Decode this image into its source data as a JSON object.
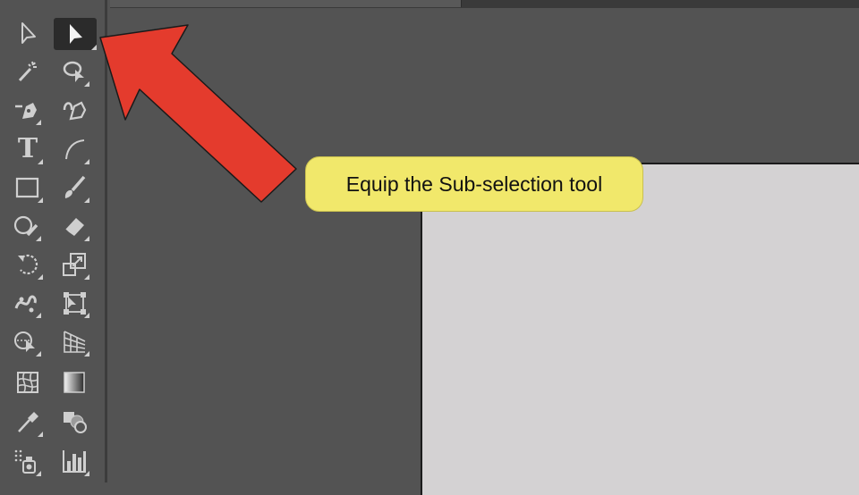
{
  "callout": {
    "text": "Equip the Sub-selection tool"
  },
  "toolbar": {
    "tools": [
      {
        "id": "selection",
        "icon": "selection-arrow-icon"
      },
      {
        "id": "direct-selection",
        "icon": "direct-selection-arrow-icon",
        "selected": true
      },
      {
        "id": "magic-wand",
        "icon": "magic-wand-icon"
      },
      {
        "id": "lasso",
        "icon": "lasso-icon"
      },
      {
        "id": "pen",
        "icon": "pen-icon"
      },
      {
        "id": "curvature",
        "icon": "curvature-pen-icon"
      },
      {
        "id": "type",
        "icon": "type-icon",
        "glyph": "T"
      },
      {
        "id": "line-segment",
        "icon": "arc-icon"
      },
      {
        "id": "rectangle",
        "icon": "rectangle-icon"
      },
      {
        "id": "paintbrush",
        "icon": "paintbrush-icon"
      },
      {
        "id": "shaper",
        "icon": "shaper-icon"
      },
      {
        "id": "eraser",
        "icon": "eraser-icon"
      },
      {
        "id": "rotate",
        "icon": "rotate-icon"
      },
      {
        "id": "scale",
        "icon": "scale-icon"
      },
      {
        "id": "puppet-warp",
        "icon": "puppet-warp-icon"
      },
      {
        "id": "free-transform",
        "icon": "free-transform-icon"
      },
      {
        "id": "shape-builder",
        "icon": "shape-builder-icon"
      },
      {
        "id": "perspective-grid",
        "icon": "perspective-grid-icon"
      },
      {
        "id": "mesh",
        "icon": "mesh-icon"
      },
      {
        "id": "gradient",
        "icon": "gradient-icon"
      },
      {
        "id": "eyedropper",
        "icon": "eyedropper-icon"
      },
      {
        "id": "blend",
        "icon": "blend-icon"
      },
      {
        "id": "symbol-sprayer",
        "icon": "symbol-sprayer-icon"
      },
      {
        "id": "column-graph",
        "icon": "column-graph-icon"
      }
    ]
  },
  "colors": {
    "workspace": "#535353",
    "toolbar_divider": "#3c3c3c",
    "artboard": "#d4d2d3",
    "callout_fill": "#f1e86b",
    "arrow_fill": "#e43b2d",
    "icon": "#cfcfcf"
  }
}
